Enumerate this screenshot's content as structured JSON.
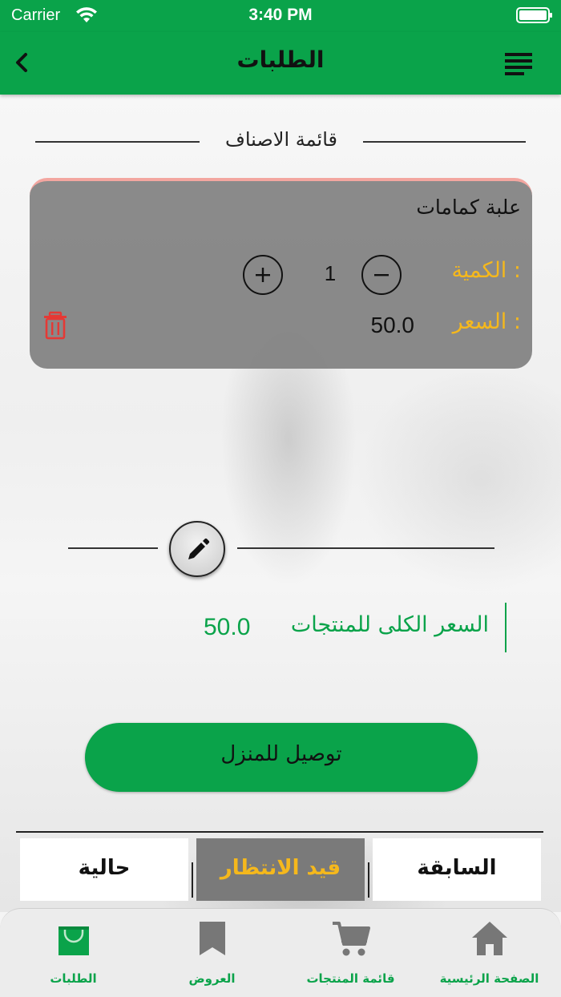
{
  "status_bar": {
    "carrier": "Carrier",
    "time": "3:40 PM",
    "icons": [
      "wifi-icon",
      "battery-icon"
    ]
  },
  "header": {
    "title": "الطلبات",
    "back_icon": "chevron-left-icon",
    "menu_icon": "menu-icon"
  },
  "section": {
    "title": "قائمة الاصناف"
  },
  "items": [
    {
      "name": "علبة كمامات",
      "quantity_label": "الكمية :",
      "quantity": "1",
      "price_label": "السعر :",
      "price": "50.0"
    }
  ],
  "total": {
    "label": "السعر الكلى للمنتجات",
    "value": "50.0"
  },
  "delivery_button": {
    "label": "توصيل للمنزل"
  },
  "order_tabs": {
    "current": "حالية",
    "pending": "قيد الانتظار",
    "previous": "السابقة",
    "selected": "pending"
  },
  "bottom_nav": [
    {
      "label": "الطلبات",
      "icon": "shopping-bag-icon",
      "active": true
    },
    {
      "label": "العروض",
      "icon": "bookmark-icon",
      "active": false
    },
    {
      "label": "قائمة المنتجات",
      "icon": "cart-icon",
      "active": false
    },
    {
      "label": "الصفحة الرئيسية",
      "icon": "home-icon",
      "active": false
    }
  ],
  "colors": {
    "primary_green": "#0aa34a",
    "accent_yellow": "#f5b81c",
    "delete_red": "#e53935",
    "card_gray": "#808080"
  }
}
